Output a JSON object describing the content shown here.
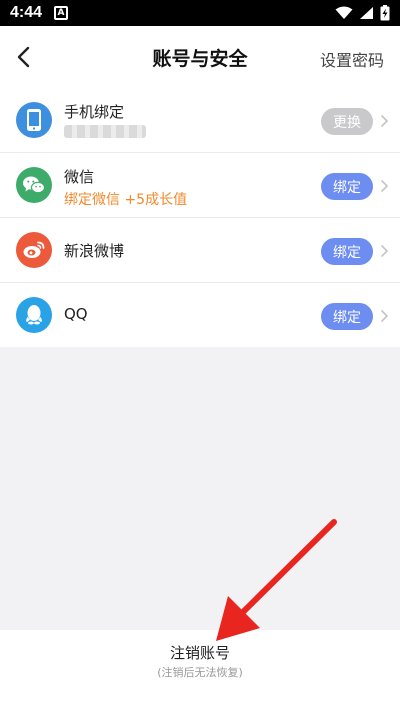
{
  "status_bar": {
    "time": "4:44",
    "notification_badge": "A",
    "icons": [
      "wifi-icon",
      "signal-icon",
      "battery-charging-icon"
    ]
  },
  "nav": {
    "title": "账号与安全",
    "right_action": "设置密码",
    "back_icon": "chevron-left-icon"
  },
  "accounts": [
    {
      "title": "手机绑定",
      "subtitle": "",
      "masked": true,
      "button": "更换",
      "button_style": "gray",
      "icon": "phone-icon",
      "icon_color": "#3d8fe0"
    },
    {
      "title": "微信",
      "subtitle": "绑定微信 +5成长值",
      "masked": false,
      "button": "绑定",
      "button_style": "blue",
      "icon": "wechat-icon",
      "icon_color": "#3dab6a"
    },
    {
      "title": "新浪微博",
      "subtitle": "",
      "masked": false,
      "button": "绑定",
      "button_style": "blue",
      "icon": "weibo-icon",
      "icon_color": "#ec5a3b"
    },
    {
      "title": "QQ",
      "subtitle": "",
      "masked": false,
      "button": "绑定",
      "button_style": "blue",
      "icon": "qq-icon",
      "icon_color": "#2aa2e6"
    }
  ],
  "footer": {
    "cancel_account": "注销账号",
    "cancel_note": "(注销后无法恢复)"
  },
  "colors": {
    "accent_blue": "#6e8df0",
    "disabled_gray": "#c9c9cc",
    "reward_orange": "#f08a2c",
    "annotation_red": "#e8251f"
  }
}
